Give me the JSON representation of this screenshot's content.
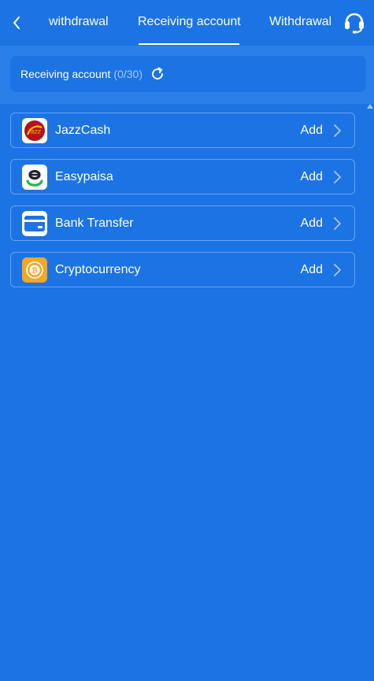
{
  "header": {
    "tabs": [
      {
        "label": "withdrawal"
      },
      {
        "label": "Receiving account"
      },
      {
        "label": "Withdrawal"
      }
    ],
    "active_tab": "Receiving account"
  },
  "summary": {
    "label": "Receiving account",
    "count": "(0/30)"
  },
  "accounts": [
    {
      "label": "JazzCash",
      "action": "Add",
      "icon": "jazzcash-logo"
    },
    {
      "label": "Easypaisa",
      "action": "Add",
      "icon": "easypaisa-logo"
    },
    {
      "label": "Bank Transfer",
      "action": "Add",
      "icon": "bank-card-icon"
    },
    {
      "label": "Cryptocurrency",
      "action": "Add",
      "icon": "cryptocurrency-coin-icon"
    }
  ],
  "colors": {
    "background": "#1c73e3",
    "panel": "#2a7fe8",
    "row_border": "#6aa4ef",
    "count_muted": "#a9c9f4",
    "crypto_orange": "#f5a623"
  }
}
